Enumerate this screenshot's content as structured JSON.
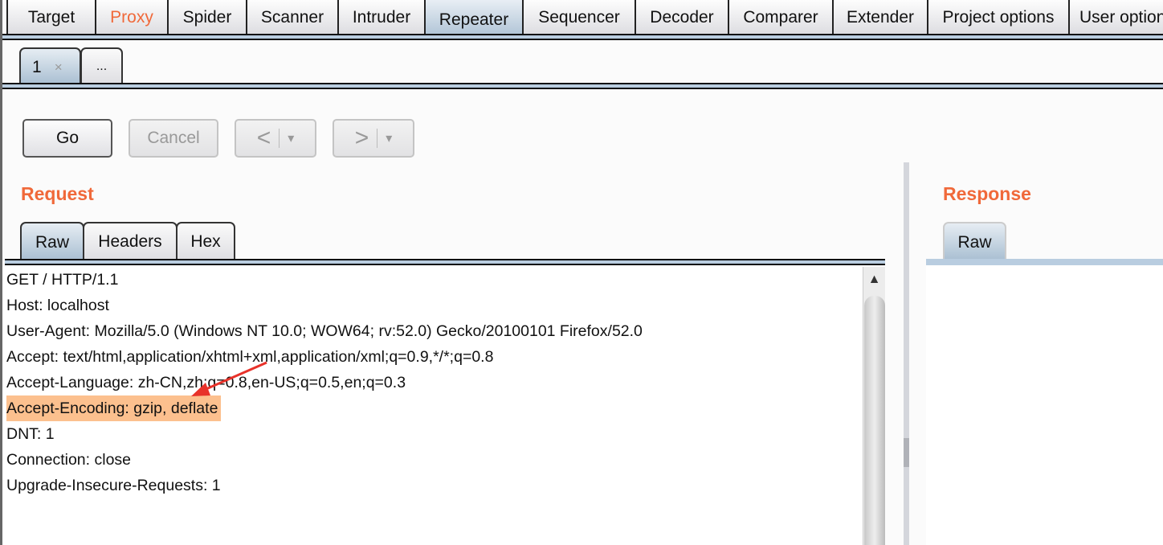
{
  "main_tabs": [
    {
      "label": "Target"
    },
    {
      "label": "Proxy",
      "color": "#f0693a"
    },
    {
      "label": "Spider"
    },
    {
      "label": "Scanner"
    },
    {
      "label": "Intruder"
    },
    {
      "label": "Repeater",
      "active": true
    },
    {
      "label": "Sequencer"
    },
    {
      "label": "Decoder"
    },
    {
      "label": "Comparer"
    },
    {
      "label": "Extender"
    },
    {
      "label": "Project options"
    },
    {
      "label": "User options"
    }
  ],
  "repeater_tabs": [
    {
      "label": "1",
      "close": "×",
      "active": true
    },
    {
      "label": "..."
    }
  ],
  "toolbar": {
    "go": "Go",
    "cancel": "Cancel",
    "back": "<",
    "forward": ">",
    "dropdown": "▾"
  },
  "request": {
    "title": "Request",
    "tabs": [
      "Raw",
      "Headers",
      "Hex"
    ],
    "lines": [
      "GET / HTTP/1.1",
      "Host: localhost",
      "User-Agent: Mozilla/5.0 (Windows NT 10.0; WOW64; rv:52.0) Gecko/20100101 Firefox/52.0",
      "Accept: text/html,application/xhtml+xml,application/xml;q=0.9,*/*;q=0.8",
      "Accept-Language: zh-CN,zh;q=0.8,en-US;q=0.5,en;q=0.3",
      "Accept-Encoding: gzip, deflate",
      "DNT: 1",
      "Connection: close",
      "Upgrade-Insecure-Requests: 1"
    ],
    "highlighted_line": "Accept-Encoding: gzip, deflate"
  },
  "response": {
    "title": "Response",
    "tabs": [
      "Raw"
    ]
  },
  "colors": {
    "accent": "#f0693a",
    "highlight": "#fcc08e",
    "annotation_arrow": "#e8322a"
  }
}
